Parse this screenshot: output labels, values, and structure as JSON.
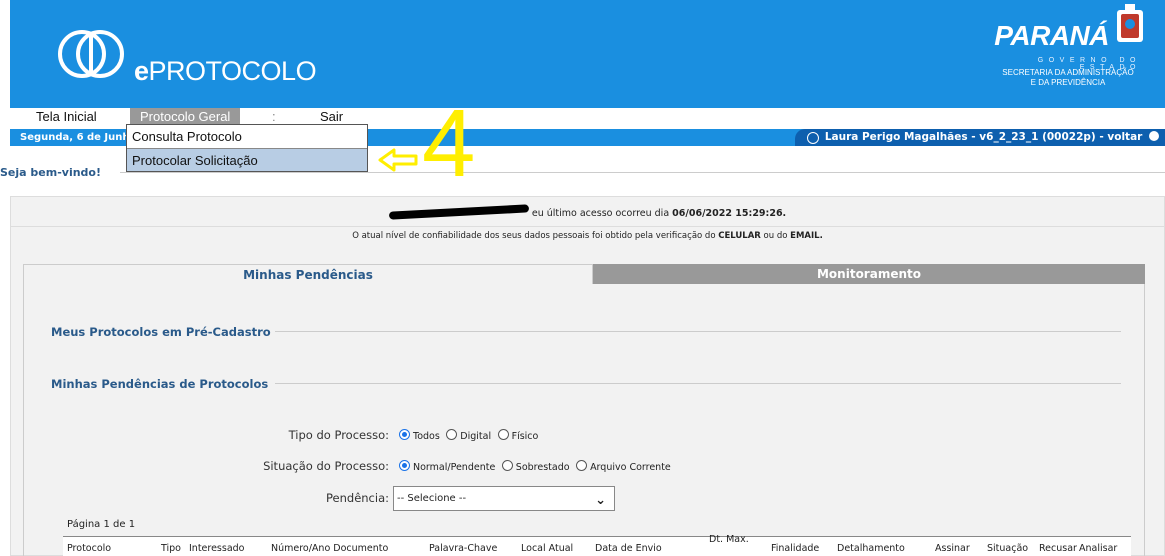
{
  "header": {
    "brand_prefix": "e",
    "brand_name": "PROTOCOLO",
    "state_name": "PARANÁ",
    "gov_line": "GOVERNO DO ESTADO",
    "secretariat_line1": "SECRETARIA DA ADMINISTRAÇÃO",
    "secretariat_line2": "E DA PREVIDÊNCIA"
  },
  "nav": {
    "items": [
      {
        "label": "Tela Inicial"
      },
      {
        "label": "Protocolo Geral"
      },
      {
        "label": "Sair"
      }
    ],
    "separator": ":"
  },
  "dropdown": {
    "items": [
      {
        "label": "Consulta Protocolo"
      },
      {
        "label": "Protocolar Solicitação"
      }
    ]
  },
  "annotation": {
    "step_number": "4",
    "color": "#ffee00"
  },
  "infobar": {
    "date_text": "Segunda, 6 de Junho",
    "user_text": "Laura Perigo Magalhães - v6_2_23_1 (00022p) - voltar"
  },
  "welcome": "Seja bem-vindo!",
  "last_access": {
    "text": "eu último acesso ocorreu dia",
    "datetime": "06/06/2022 15:29:26."
  },
  "reliability": {
    "prefix": "O atual nível de confiabilidade dos seus dados pessoais foi obtido pela verificação do",
    "celular": "CELULAR",
    "mid": "ou do",
    "email": "EMAIL."
  },
  "tabs": [
    {
      "label": "Minhas Pendências",
      "active": true
    },
    {
      "label": "Monitoramento",
      "active": false
    }
  ],
  "sections": {
    "pre_cadastro": "Meus Protocolos em Pré-Cadastro",
    "pendencias": "Minhas Pendências de Protocolos"
  },
  "filters": {
    "tipo_label": "Tipo do Processo:",
    "tipo_options": [
      "Todos",
      "Digital",
      "Físico"
    ],
    "tipo_selected": "Todos",
    "situacao_label": "Situação do Processo:",
    "situacao_options": [
      "Normal/Pendente",
      "Sobrestado",
      "Arquivo Corrente"
    ],
    "situacao_selected": "Normal/Pendente",
    "pendencia_label": "Pendência:",
    "pendencia_value": "-- Selecione --"
  },
  "pager": "Página 1 de 1",
  "table": {
    "columns": [
      "Protocolo",
      "Tipo",
      "Interessado",
      "Número/Ano Documento",
      "Palavra-Chave",
      "Local Atual",
      "Data de Envio",
      "Dt. Max.",
      "Finalidade",
      "Detalhamento",
      "Assinar",
      "Situação",
      "Recusar",
      "Analisar"
    ]
  },
  "colors": {
    "header_blue": "#1a8fe0",
    "dark_blue": "#0d5fae",
    "tab_gray": "#999999",
    "title_blue": "#2a5a8a"
  }
}
